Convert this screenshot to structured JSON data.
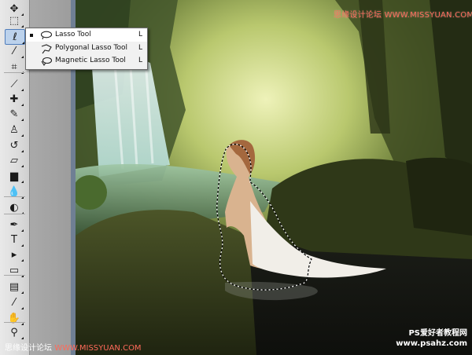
{
  "toolbar": {
    "tools": [
      {
        "name": "move-tool",
        "glyph": "✥"
      },
      {
        "name": "marquee-tool",
        "glyph": "⬚"
      },
      {
        "name": "lasso-tool",
        "glyph": "ℓ"
      },
      {
        "name": "magic-wand-tool",
        "glyph": "⁄"
      },
      {
        "name": "crop-tool",
        "glyph": "⌗"
      },
      {
        "name": "slice-tool",
        "glyph": "⟋"
      },
      {
        "name": "healing-brush-tool",
        "glyph": "✚"
      },
      {
        "name": "brush-tool",
        "glyph": "✎"
      },
      {
        "name": "clone-stamp-tool",
        "glyph": "♙"
      },
      {
        "name": "history-brush-tool",
        "glyph": "↺"
      },
      {
        "name": "eraser-tool",
        "glyph": "▱"
      },
      {
        "name": "gradient-tool",
        "glyph": "▆"
      },
      {
        "name": "blur-tool",
        "glyph": "💧"
      },
      {
        "name": "dodge-tool",
        "glyph": "◐"
      },
      {
        "name": "pen-tool",
        "glyph": "✒"
      },
      {
        "name": "type-tool",
        "glyph": "T"
      },
      {
        "name": "path-selection-tool",
        "glyph": "▸"
      },
      {
        "name": "shape-tool",
        "glyph": "▭"
      },
      {
        "name": "notes-tool",
        "glyph": "▤"
      },
      {
        "name": "eyedropper-tool",
        "glyph": "⁄"
      },
      {
        "name": "hand-tool",
        "glyph": "✋"
      },
      {
        "name": "zoom-tool",
        "glyph": "⚲"
      }
    ]
  },
  "flyout": {
    "items": [
      {
        "label": "Lasso Tool",
        "shortcut": "L",
        "selected": true
      },
      {
        "label": "Polygonal Lasso Tool",
        "shortcut": "L",
        "selected": false
      },
      {
        "label": "Magnetic Lasso Tool",
        "shortcut": "L",
        "selected": false
      }
    ]
  },
  "watermarks": {
    "top_right": "思缘设计论坛  WWW.MISSYUAN.COM",
    "bottom_left_cn": "思缘设计论坛 ",
    "bottom_left_url": "WWW.MISSYUAN.COM",
    "bottom_right_line1": "PS爱好者教程网",
    "bottom_right_line2": "www.psahz.com"
  }
}
